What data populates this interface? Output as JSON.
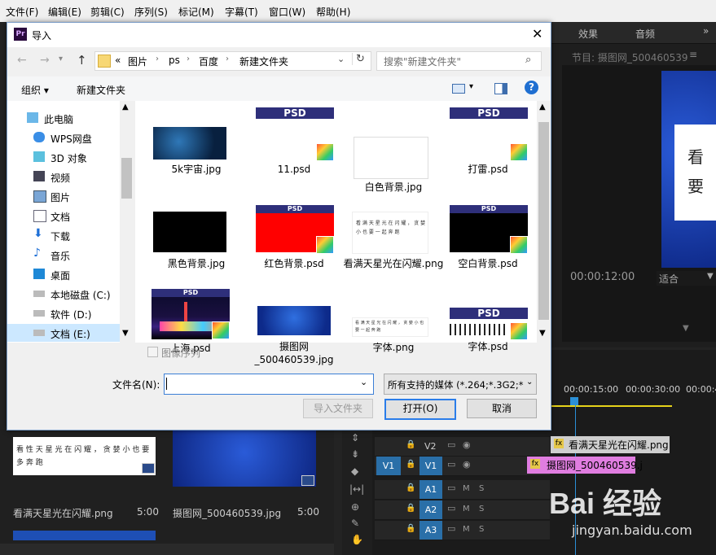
{
  "menubar": {
    "items": [
      "文件(F)",
      "编辑(E)",
      "剪辑(C)",
      "序列(S)",
      "标记(M)",
      "字幕(T)",
      "窗口(W)",
      "帮助(H)"
    ]
  },
  "premiere": {
    "tabs": [
      "效果",
      "音频"
    ],
    "program_title": "节目: 摄图网_500460539",
    "program_card_text": "看\n要",
    "timecode": "00:00:12:00",
    "fit_label": "适合",
    "ruler_ticks": [
      "00:00:15:00",
      "00:00:30:00",
      "00:00:4"
    ],
    "tracks": [
      "V2",
      "V1",
      "A1",
      "A2",
      "A3"
    ],
    "v1_target": "V1",
    "track_letters": {
      "mute": "M",
      "solo": "S"
    },
    "clips": {
      "v2": "看满天星光在闪耀.png",
      "v1": "摄图网_500460539.j"
    },
    "project_items": [
      {
        "name": "看满天星光在闪耀.png",
        "duration": "5:00",
        "text": "看 性 天 星 光 在 闪 耀 ， 贪 婪 小 也 要 多 奔 跑"
      },
      {
        "name": "摄图网_500460539.jpg",
        "duration": "5:00"
      }
    ]
  },
  "dialog": {
    "title": "导入",
    "app_badge": "Pr",
    "breadcrumb": [
      "«",
      "图片",
      "ps",
      "百度",
      "新建文件夹"
    ],
    "search_placeholder": "搜索\"新建文件夹\"",
    "toolbar": {
      "organize": "组织 ▾",
      "new_folder": "新建文件夹"
    },
    "nav_items": [
      "此电脑",
      "WPS网盘",
      "3D 对象",
      "视频",
      "图片",
      "文档",
      "下载",
      "音乐",
      "桌面",
      "本地磁盘 (C:)",
      "软件 (D:)",
      "文档 (E:)"
    ],
    "files": [
      {
        "name": "5k宇宙.jpg",
        "kind": "space"
      },
      {
        "name": "11.psd",
        "kind": "psd-blank"
      },
      {
        "name": "白色背景.jpg",
        "kind": "white"
      },
      {
        "name": "打雷.psd",
        "kind": "psd-blank"
      },
      {
        "name": "黑色背景.jpg",
        "kind": "black"
      },
      {
        "name": "红色背景.psd",
        "kind": "psd-red"
      },
      {
        "name": "看满天星光在闪耀.png",
        "kind": "text"
      },
      {
        "name": "空白背景.psd",
        "kind": "psd-black"
      },
      {
        "name": "上海.psd",
        "kind": "psd-city"
      },
      {
        "name": "摄图网_500460539.jpg",
        "kind": "space2"
      },
      {
        "name": "字体.png",
        "kind": "text2"
      },
      {
        "name": "字体.psd",
        "kind": "psd-text"
      }
    ],
    "psd_label": "PSD",
    "thumb_text_1": "看 满 天 星 光 在 闪 耀 ， 贪 婪 小 也 要 一 起 奔 跑",
    "thumb_text_2": "看 满 天 星 光 在 闪 耀 ， 贪 婪 小 也 要 一 起 奔 跑",
    "image_sequence_label": "图像序列",
    "filename_label": "文件名(N):",
    "filename_value": "",
    "filetype_value": "所有支持的媒体 (*.264;*.3G2;*",
    "btn_import_folder": "导入文件夹",
    "btn_open": "打开(O)",
    "btn_cancel": "取消"
  },
  "watermark": {
    "text": "Bai 经验",
    "sub": "jingyan.baidu.com"
  }
}
